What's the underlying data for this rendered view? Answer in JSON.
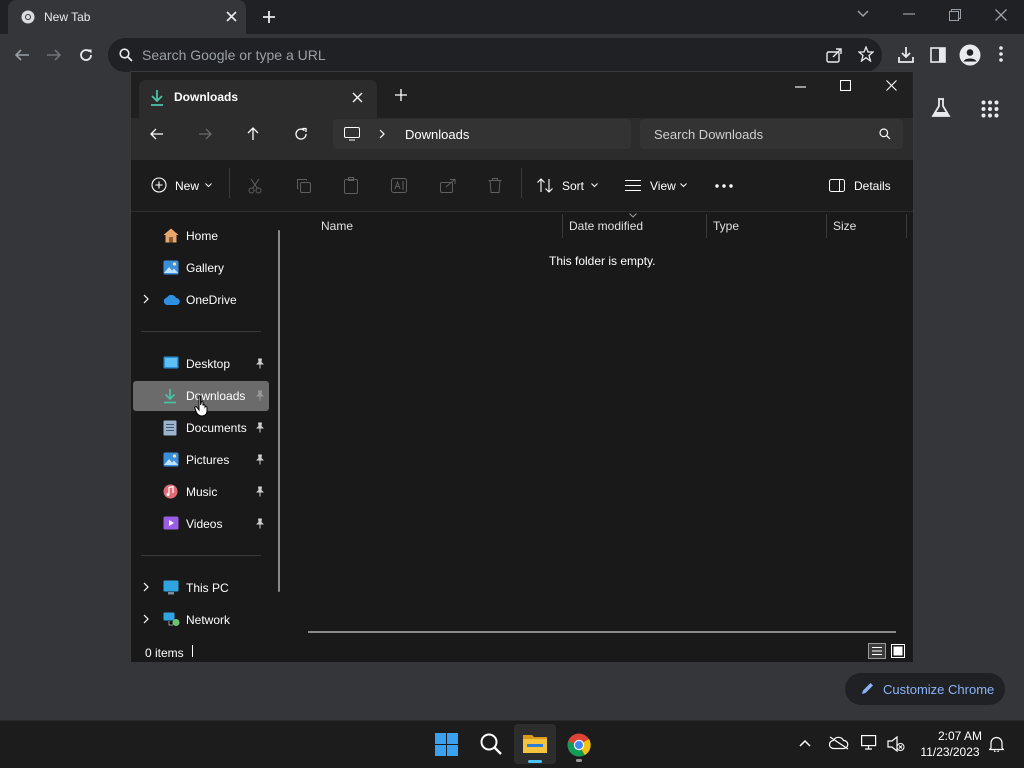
{
  "browser": {
    "tab_title": "New Tab",
    "omnibox_placeholder": "Search Google or type a URL",
    "customize_label": "Customize Chrome"
  },
  "explorer": {
    "tab_title": "Downloads",
    "breadcrumb": "Downloads",
    "search_placeholder": "Search Downloads",
    "commands": {
      "new": "New",
      "sort": "Sort",
      "view": "View",
      "details": "Details"
    },
    "nav": {
      "home": "Home",
      "gallery": "Gallery",
      "onedrive": "OneDrive",
      "desktop": "Desktop",
      "downloads": "Downloads",
      "documents": "Documents",
      "pictures": "Pictures",
      "music": "Music",
      "videos": "Videos",
      "thispc": "This PC",
      "network": "Network"
    },
    "columns": [
      "Name",
      "Date modified",
      "Type",
      "Size"
    ],
    "empty_message": "This folder is empty.",
    "status": "0 items"
  },
  "taskbar": {
    "time": "2:07 AM",
    "date": "11/23/2023"
  },
  "colors": {
    "accent_green": "#4cc2a4",
    "chrome_link": "#8ab4f8",
    "folder_yellow": "#f5c43c"
  }
}
